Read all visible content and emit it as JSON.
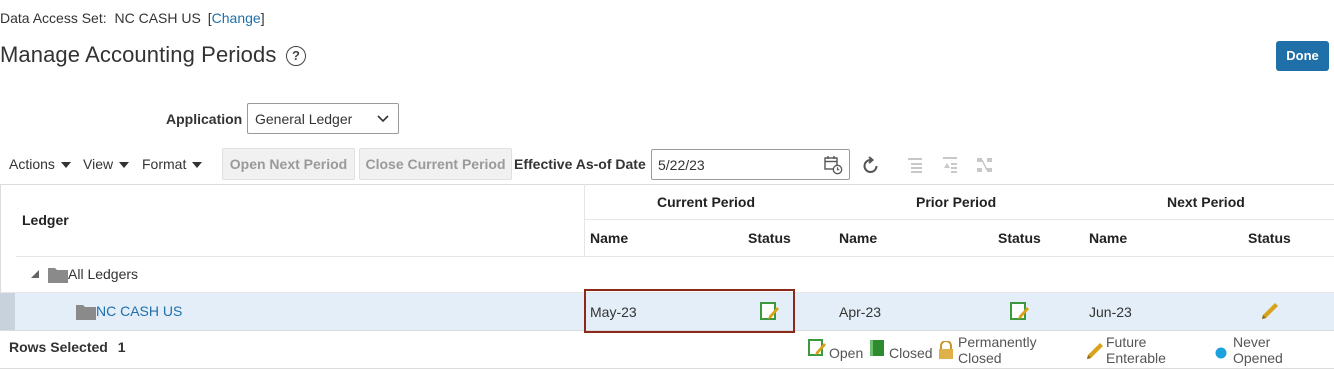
{
  "header": {
    "data_access_label": "Data Access Set:",
    "data_access_value": "NC CASH US",
    "change_link": "Change",
    "title": "Manage Accounting Periods",
    "help_glyph": "?",
    "done_label": "Done"
  },
  "filters": {
    "application_label": "Application",
    "application_value": "General Ledger"
  },
  "toolbar": {
    "actions": "Actions",
    "view": "View",
    "format": "Format",
    "open_next": "Open Next Period",
    "close_current": "Close Current Period",
    "effective_label": "Effective As-of Date",
    "effective_value": "5/22/23"
  },
  "table": {
    "ledger_header": "Ledger",
    "current_period": "Current Period",
    "prior_period": "Prior Period",
    "next_period": "Next Period",
    "name_header": "Name",
    "status_header": "Status",
    "rows": [
      {
        "ledger": "All Ledgers"
      },
      {
        "ledger": "NC CASH US",
        "current_name": "May-23",
        "current_status": "Open",
        "prior_name": "Apr-23",
        "prior_status": "Open",
        "next_name": "Jun-23",
        "next_status": "Future Enterable"
      }
    ]
  },
  "footer": {
    "rows_selected_label": "Rows Selected",
    "rows_selected_value": "1",
    "legend": {
      "open": "Open",
      "closed": "Closed",
      "perm_1": "Permanently",
      "perm_2": "Closed",
      "future_1": "Future",
      "future_2": "Enterable",
      "never_1": "Never",
      "never_2": "Opened"
    }
  },
  "colors": {
    "accent": "#1f6fa8",
    "open_green": "#3b9a3b",
    "future_pencil": "#d9a21b",
    "never_dot": "#1ba3e0",
    "highlight_border": "#8b2a1a",
    "selected_row": "#e4eef8"
  },
  "icons": {
    "help": "help-icon",
    "calendar": "calendar-icon",
    "refresh": "refresh-icon",
    "open_status": "open-status-icon",
    "future_status": "pencil-icon",
    "folder": "folder-icon"
  }
}
